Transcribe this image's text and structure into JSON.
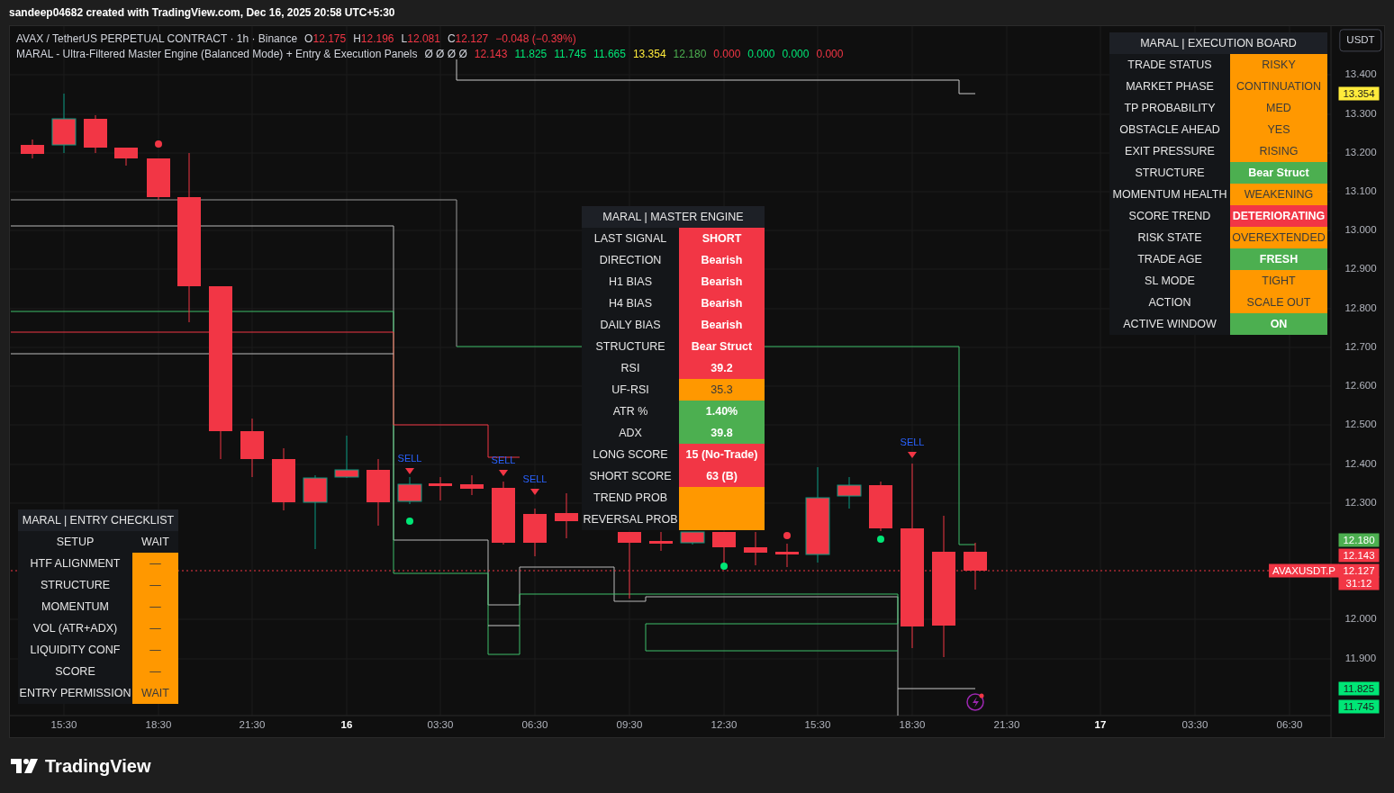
{
  "caption": "sandeep04682 created with TradingView.com, Dec 16, 2025 20:58 UTC+5:30",
  "legend": {
    "symbol": "AVAX / TetherUS PERPETUAL CONTRACT · 1h · Binance",
    "ohlc": [
      {
        "label": "O",
        "value": "12.175"
      },
      {
        "label": "H",
        "value": "12.196"
      },
      {
        "label": "L",
        "value": "12.081"
      },
      {
        "label": "C",
        "value": "12.127"
      }
    ],
    "change": "−0.048 (−0.39%)",
    "indicator": "MARAL - Ultra-Filtered Master Engine (Balanced Mode) + Entry & Execution Panels",
    "placeholders": "Ø Ø Ø Ø",
    "values": [
      {
        "text": "12.143",
        "color": "#f23645"
      },
      {
        "text": "11.825",
        "color": "#00e676"
      },
      {
        "text": "11.745",
        "color": "#00e676"
      },
      {
        "text": "11.665",
        "color": "#00e676"
      },
      {
        "text": "13.354",
        "color": "#ffeb3b"
      },
      {
        "text": "12.180",
        "color": "#4caf50"
      },
      {
        "text": "0.000",
        "color": "#f23645"
      },
      {
        "text": "0.000",
        "color": "#00e676"
      },
      {
        "text": "0.000",
        "color": "#00e676"
      },
      {
        "text": "0.000",
        "color": "#f23645"
      }
    ]
  },
  "signals": [
    {
      "label": "SELL"
    },
    {
      "label": "SELL"
    },
    {
      "label": "SELL"
    },
    {
      "label": "SELL"
    }
  ],
  "master_engine": {
    "title": "MARAL | MASTER ENGINE",
    "rows": [
      {
        "label": "LAST SIGNAL",
        "value": "SHORT",
        "color": "#f23645"
      },
      {
        "label": "DIRECTION",
        "value": "Bearish",
        "color": "#f23645"
      },
      {
        "label": "H1 BIAS",
        "value": "Bearish",
        "color": "#f23645"
      },
      {
        "label": "H4 BIAS",
        "value": "Bearish",
        "color": "#f23645"
      },
      {
        "label": "DAILY BIAS",
        "value": "Bearish",
        "color": "#f23645"
      },
      {
        "label": "STRUCTURE",
        "value": "Bear Struct",
        "color": "#f23645"
      },
      {
        "label": "RSI",
        "value": "39.2",
        "color": "#f23645"
      },
      {
        "label": "UF-RSI",
        "value": "35.3",
        "color": "#ff9800"
      },
      {
        "label": "ATR %",
        "value": "1.40%",
        "color": "#4caf50"
      },
      {
        "label": "ADX",
        "value": "39.8",
        "color": "#4caf50"
      },
      {
        "label": "LONG SCORE",
        "value": "15 (No-Trade)",
        "color": "#f23645"
      },
      {
        "label": "SHORT SCORE",
        "value": "63 (B)",
        "color": "#f23645"
      },
      {
        "label": "TREND PROB",
        "color": "#ff9800"
      },
      {
        "label": "REVERSAL PROB",
        "color": "#ff9800"
      }
    ]
  },
  "execution_board": {
    "title": "MARAL | EXECUTION BOARD",
    "rows": [
      {
        "label": "TRADE STATUS",
        "value": "RISKY",
        "color": "#ff9800"
      },
      {
        "label": "MARKET PHASE",
        "value": "CONTINUATION",
        "color": "#ff9800"
      },
      {
        "label": "TP PROBABILITY",
        "value": "MED",
        "color": "#ff9800"
      },
      {
        "label": "OBSTACLE AHEAD",
        "value": "YES",
        "color": "#ff9800"
      },
      {
        "label": "EXIT PRESSURE",
        "value": "RISING",
        "color": "#ff9800"
      },
      {
        "label": "STRUCTURE",
        "value": "Bear Struct",
        "color": "#4caf50"
      },
      {
        "label": "MOMENTUM HEALTH",
        "value": "WEAKENING",
        "color": "#ff9800"
      },
      {
        "label": "SCORE TREND",
        "value": "DETERIORATING",
        "color": "#f23645"
      },
      {
        "label": "RISK STATE",
        "value": "OVEREXTENDED",
        "color": "#ff9800"
      },
      {
        "label": "TRADE AGE",
        "value": "FRESH",
        "color": "#4caf50"
      },
      {
        "label": "SL MODE",
        "value": "TIGHT",
        "color": "#ff9800"
      },
      {
        "label": "ACTION",
        "value": "SCALE OUT",
        "color": "#ff9800"
      },
      {
        "label": "ACTIVE WINDOW",
        "value": "ON",
        "color": "#4caf50"
      }
    ]
  },
  "entry_checklist": {
    "title": "MARAL | ENTRY CHECKLIST",
    "rows": [
      {
        "label": "SETUP",
        "value": "WAIT"
      },
      {
        "label": "HTF ALIGNMENT",
        "value": "—",
        "color": "#ff9800"
      },
      {
        "label": "STRUCTURE",
        "value": "—",
        "color": "#ff9800"
      },
      {
        "label": "MOMENTUM",
        "value": "—",
        "color": "#ff9800"
      },
      {
        "label": "VOL (ATR+ADX)",
        "value": "—",
        "color": "#ff9800"
      },
      {
        "label": "LIQUIDITY CONF",
        "value": "—",
        "color": "#ff9800"
      },
      {
        "label": "SCORE",
        "value": "—",
        "color": "#ff9800"
      },
      {
        "label": "ENTRY PERMISSION",
        "value": "WAIT",
        "color": "#ff9800"
      }
    ]
  },
  "price_axis": {
    "currency": "USDT",
    "ticks": [
      "13.400",
      "13.300",
      "13.200",
      "13.100",
      "13.000",
      "12.900",
      "12.800",
      "12.700",
      "12.600",
      "12.500",
      "12.400",
      "12.300",
      "12.000",
      "11.900"
    ],
    "badges": [
      {
        "text": "13.354",
        "color": "#ffeb3b"
      },
      {
        "text": "12.180",
        "color": "#4caf50"
      },
      {
        "text": "12.143",
        "color": "#f23645"
      },
      {
        "text": "12.127",
        "color": "#f23645"
      },
      {
        "text": "31:12",
        "color": "#f23645"
      },
      {
        "text": "11.825",
        "color": "#00e676"
      },
      {
        "text": "11.745",
        "color": "#00e676"
      }
    ],
    "symbol_badge": "AVAXUSDT.P"
  },
  "time_axis": [
    {
      "label": "15:30",
      "major": false
    },
    {
      "label": "18:30",
      "major": false
    },
    {
      "label": "21:30",
      "major": false
    },
    {
      "label": "16",
      "major": true
    },
    {
      "label": "03:30",
      "major": false
    },
    {
      "label": "06:30",
      "major": false
    },
    {
      "label": "09:30",
      "major": false
    },
    {
      "label": "12:30",
      "major": false
    },
    {
      "label": "15:30",
      "major": false
    },
    {
      "label": "18:30",
      "major": false
    },
    {
      "label": "21:30",
      "major": false
    },
    {
      "label": "17",
      "major": true
    },
    {
      "label": "03:30",
      "major": false
    },
    {
      "label": "06:30",
      "major": false
    }
  ],
  "footer": {
    "brand": "TradingView"
  }
}
